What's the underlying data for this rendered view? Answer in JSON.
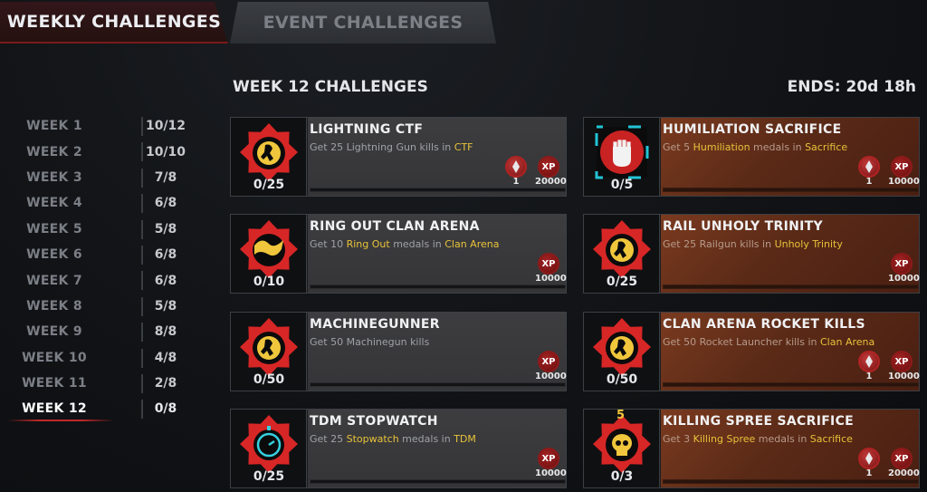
{
  "tabs": [
    {
      "label": "WEEKLY CHALLENGES",
      "active": true
    },
    {
      "label": "EVENT CHALLENGES",
      "active": false
    }
  ],
  "header": {
    "section_title": "WEEK 12 CHALLENGES",
    "ends": "ENDS: 20d 18h"
  },
  "weeks": [
    {
      "label": "WEEK 1",
      "progress": "10/12"
    },
    {
      "label": "WEEK 2",
      "progress": "10/10"
    },
    {
      "label": "WEEK 3",
      "progress": "7/8"
    },
    {
      "label": "WEEK 4",
      "progress": "6/8"
    },
    {
      "label": "WEEK 5",
      "progress": "5/8"
    },
    {
      "label": "WEEK 6",
      "progress": "6/8"
    },
    {
      "label": "WEEK 7",
      "progress": "6/8"
    },
    {
      "label": "WEEK 8",
      "progress": "5/8"
    },
    {
      "label": "WEEK 9",
      "progress": "8/8"
    },
    {
      "label": "WEEK 10",
      "progress": "4/8"
    },
    {
      "label": "WEEK 11",
      "progress": "2/8"
    },
    {
      "label": "WEEK 12",
      "progress": "0/8",
      "active": true
    }
  ],
  "challenges": [
    {
      "title": "LIGHTNING CTF",
      "progress": "0/25",
      "style": "gray",
      "icon": "lightning-medal-icon",
      "desc": [
        {
          "t": "Get 25 Lightning Gun kills in "
        },
        {
          "t": "CTF",
          "hl": true
        }
      ],
      "medal": "1",
      "xp_label": "XP",
      "xp": "20000"
    },
    {
      "title": "HUMILIATION SACRIFICE",
      "progress": "0/5",
      "style": "orange",
      "icon": "humiliation-fist-icon",
      "desc": [
        {
          "t": "Get 5 "
        },
        {
          "t": "Humiliation",
          "hl": true
        },
        {
          "t": " medals in "
        },
        {
          "t": "Sacrifice",
          "hl": true
        }
      ],
      "medal": "1",
      "xp_label": "XP",
      "xp": "10000"
    },
    {
      "title": "RING OUT CLAN ARENA",
      "progress": "0/10",
      "style": "gray",
      "icon": "ring-out-icon",
      "desc": [
        {
          "t": "Get 10 "
        },
        {
          "t": "Ring Out",
          "hl": true
        },
        {
          "t": " medals in "
        },
        {
          "t": "Clan Arena",
          "hl": true
        }
      ],
      "medal": null,
      "xp_label": "XP",
      "xp": "10000"
    },
    {
      "title": "RAIL UNHOLY TRINITY",
      "progress": "0/25",
      "style": "orange",
      "icon": "railgun-medal-icon",
      "desc": [
        {
          "t": "Get 25 Railgun kills in "
        },
        {
          "t": "Unholy Trinity",
          "hl": true
        }
      ],
      "medal": null,
      "xp_label": "XP",
      "xp": "10000"
    },
    {
      "title": "MACHINEGUNNER",
      "progress": "0/50",
      "style": "gray",
      "icon": "machinegun-medal-icon",
      "desc": [
        {
          "t": "Get 50 Machinegun kills"
        }
      ],
      "medal": null,
      "xp_label": "XP",
      "xp": "10000"
    },
    {
      "title": "CLAN ARENA ROCKET KILLS",
      "progress": "0/50",
      "style": "orange",
      "icon": "rocket-medal-icon",
      "desc": [
        {
          "t": "Get 50 Rocket Launcher kills in "
        },
        {
          "t": "Clan Arena",
          "hl": true
        }
      ],
      "medal": "1",
      "xp_label": "XP",
      "xp": "10000"
    },
    {
      "title": "TDM STOPWATCH",
      "progress": "0/25",
      "style": "gray",
      "icon": "stopwatch-icon",
      "desc": [
        {
          "t": "Get 25 "
        },
        {
          "t": "Stopwatch",
          "hl": true
        },
        {
          "t": " medals in "
        },
        {
          "t": "TDM",
          "hl": true
        }
      ],
      "medal": null,
      "xp_label": "XP",
      "xp": "10000"
    },
    {
      "title": "KILLING SPREE SACRIFICE",
      "progress": "0/3",
      "style": "orange",
      "icon": "skull-spree-icon",
      "badge_number": "5",
      "desc": [
        {
          "t": "Get 3 "
        },
        {
          "t": "Killing Spree",
          "hl": true
        },
        {
          "t": " medals in "
        },
        {
          "t": "Sacrifice",
          "hl": true
        }
      ],
      "medal": "1",
      "xp_label": "XP",
      "xp": "20000"
    }
  ]
}
